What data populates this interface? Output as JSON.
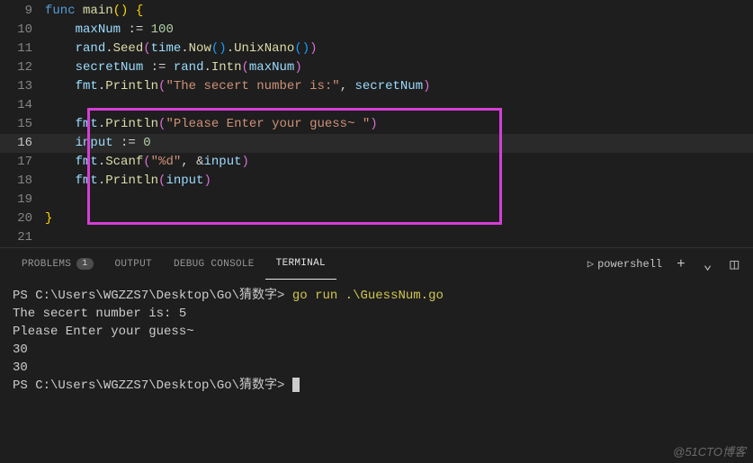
{
  "editor": {
    "lines": {
      "9": {
        "num": "9"
      },
      "10": {
        "num": "10"
      },
      "11": {
        "num": "11"
      },
      "12": {
        "num": "12"
      },
      "13": {
        "num": "13"
      },
      "14": {
        "num": "14"
      },
      "15": {
        "num": "15"
      },
      "16": {
        "num": "16"
      },
      "17": {
        "num": "17"
      },
      "18": {
        "num": "18"
      },
      "19": {
        "num": "19"
      },
      "20": {
        "num": "20"
      },
      "21": {
        "num": "21"
      }
    },
    "tokens": {
      "func": "func",
      "main": "main",
      "maxNum": "maxNum",
      "assign": ":=",
      "hundred": "100",
      "rand": "rand",
      "Seed": "Seed",
      "time": "time",
      "Now": "Now",
      "UnixNano": "UnixNano",
      "secretNum": "secretNum",
      "Intn": "Intn",
      "fmt": "fmt",
      "Println": "Println",
      "secretStr": "\"The secert number is:\"",
      "pleaseStr": "\"Please Enter your guess~ \"",
      "input": "input",
      "zero": "0",
      "Scanf": "Scanf",
      "fmtD": "\"%d\"",
      "amp": "&"
    }
  },
  "panel": {
    "tabs": {
      "problems": "PROBLEMS",
      "problemsBadge": "1",
      "output": "OUTPUT",
      "debug": "DEBUG CONSOLE",
      "terminal": "TERMINAL"
    },
    "right": {
      "shell": "powershell",
      "plus": "+",
      "chev": "⌄",
      "split": "◫"
    }
  },
  "terminal": {
    "prompt1": "PS C:\\Users\\WGZZS7\\Desktop\\Go\\猜数字>",
    "cmd": "go run .\\GuessNum.go",
    "out1": "The secert number is: 5",
    "out2": "Please Enter your guess~",
    "out3": "30",
    "out4": "30",
    "prompt2": "PS C:\\Users\\WGZZS7\\Desktop\\Go\\猜数字>"
  },
  "watermark": "@51CTO博客"
}
